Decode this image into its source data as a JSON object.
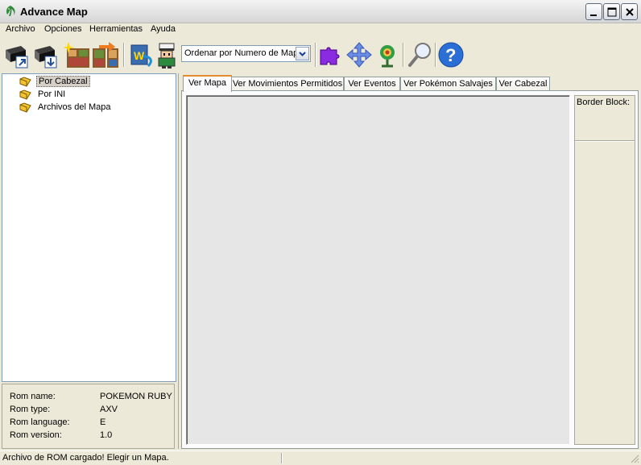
{
  "window": {
    "title": "Advance Map",
    "app_icon": "leaf-icon"
  },
  "menu": {
    "items": [
      "Archivo",
      "Opciones",
      "Herramientas",
      "Ayuda"
    ]
  },
  "toolbar": {
    "sort_select_value": "Ordenar por Numero de Mapa",
    "buttons": [
      "open-rom-icon",
      "save-rom-icon",
      "map-header-icon",
      "connections-icon",
      "word-map-icon",
      "trainer-icon",
      "puzzle-icon",
      "move-arrows-icon",
      "wild-pokemon-icon",
      "search-icon",
      "help-icon"
    ]
  },
  "tree": {
    "items": [
      {
        "label": "Por Cabezal",
        "selected": true
      },
      {
        "label": "Por INI",
        "selected": false
      },
      {
        "label": "Archivos del Mapa",
        "selected": false
      }
    ]
  },
  "rom_info": {
    "rows": [
      {
        "label": "Rom name:",
        "value": "POKEMON RUBY"
      },
      {
        "label": "Rom type:",
        "value": "AXV"
      },
      {
        "label": "Rom language:",
        "value": "E"
      },
      {
        "label": "Rom version:",
        "value": "1.0"
      }
    ]
  },
  "tabs": [
    {
      "label": "Ver Mapa",
      "active": true
    },
    {
      "label": "Ver Movimientos Permitidos",
      "active": false
    },
    {
      "label": "Ver Eventos",
      "active": false
    },
    {
      "label": "Ver Pokémon Salvajes",
      "active": false
    },
    {
      "label": "Ver Cabezal",
      "active": false
    }
  ],
  "border_block": {
    "label": "Border Block:"
  },
  "status": {
    "text": "Archivo de ROM cargado! Elegir un Mapa."
  }
}
